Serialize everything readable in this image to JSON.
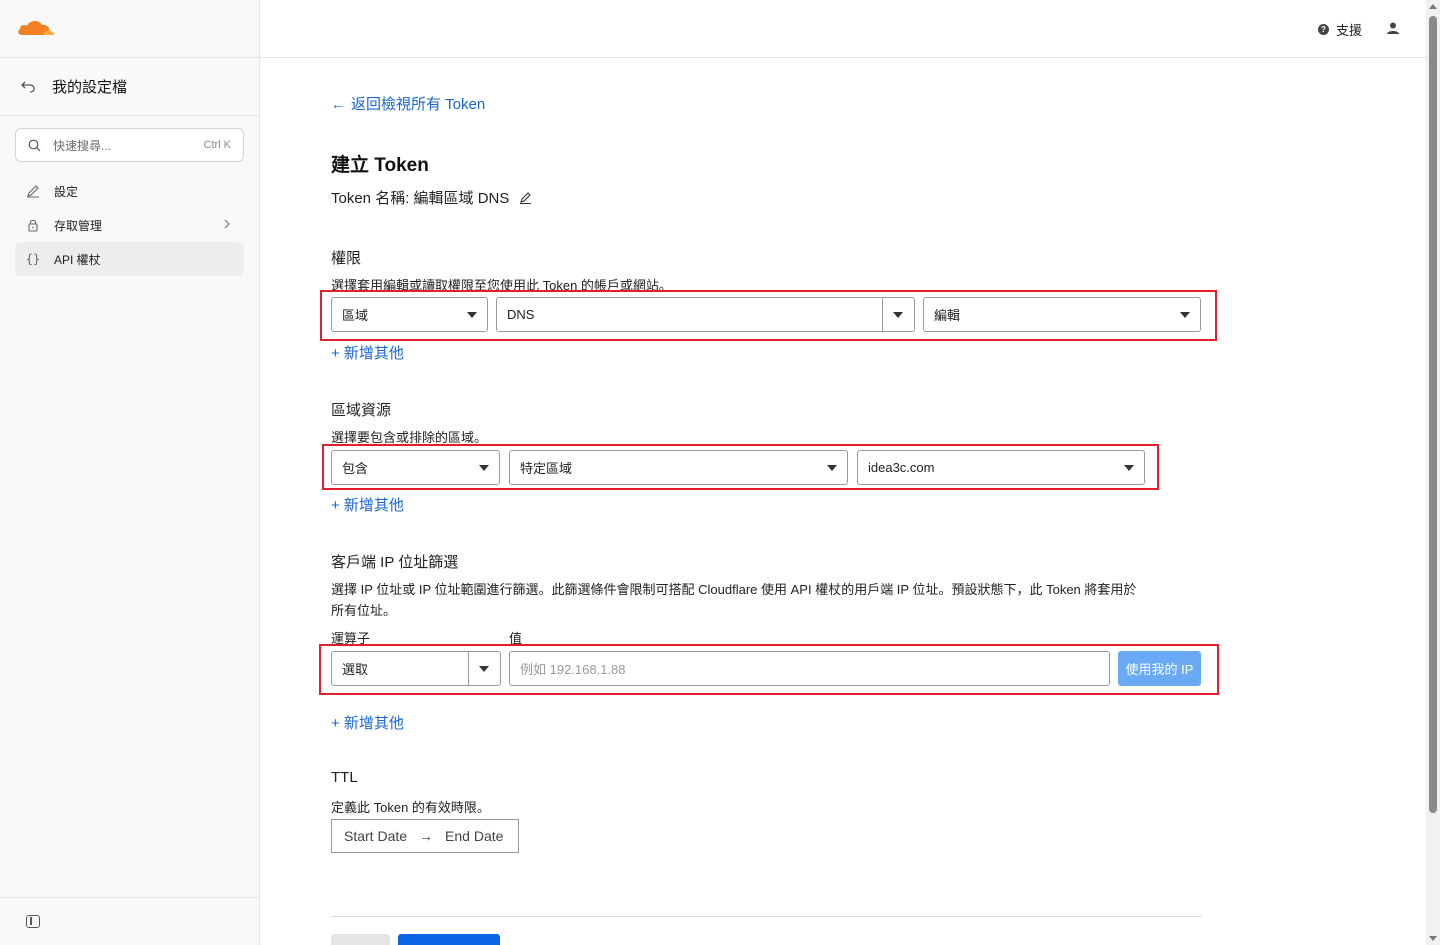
{
  "sidebar": {
    "back_title": "我的設定檔",
    "search_placeholder": "快速搜尋...",
    "search_shortcut": "Ctrl K",
    "items": [
      {
        "label": "設定",
        "icon": "pencil-icon"
      },
      {
        "label": "存取管理",
        "icon": "lock-icon"
      },
      {
        "label": "API 權杖",
        "icon": "braces-icon"
      }
    ]
  },
  "topbar": {
    "support_label": "支援"
  },
  "main": {
    "back_link": "返回檢視所有 Token",
    "page_title": "建立 Token",
    "token_name": "Token 名稱: 編輯區域 DNS",
    "permissions": {
      "title": "權限",
      "desc": "選擇套用編輯或讀取權限至您使用此 Token 的帳戶或網站。",
      "scope": "區域",
      "resource": "DNS",
      "level": "編輯",
      "add_more": "+ 新增其他"
    },
    "zone_resources": {
      "title": "區域資源",
      "desc": "選擇要包含或排除的區域。",
      "include": "包含",
      "type": "特定區域",
      "zone": "idea3c.com",
      "add_more": "+ 新增其他"
    },
    "ip_filter": {
      "title": "客戶端 IP 位址篩選",
      "desc_line1": "選擇 IP 位址或 IP 位址範圍進行篩選。此篩選條件會限制可搭配 Cloudflare 使用 API 權杖的用戶端 IP 位址。預設狀態下，此 Token 將套用於",
      "desc_line2": "所有位址。",
      "operator_label": "運算子",
      "value_label": "值",
      "operator_value": "選取",
      "value_placeholder": "例如 192.168.1.88",
      "use_my_ip": "使用我的 IP",
      "add_more": "+ 新增其他"
    },
    "ttl": {
      "title": "TTL",
      "desc": "定義此 Token 的有效時限。",
      "start": "Start Date",
      "end": "End Date"
    }
  },
  "colors": {
    "link": "#1a66d6",
    "highlight": "#e0202f",
    "primary": "#0b63e5",
    "brand_orange": "#f38020"
  }
}
